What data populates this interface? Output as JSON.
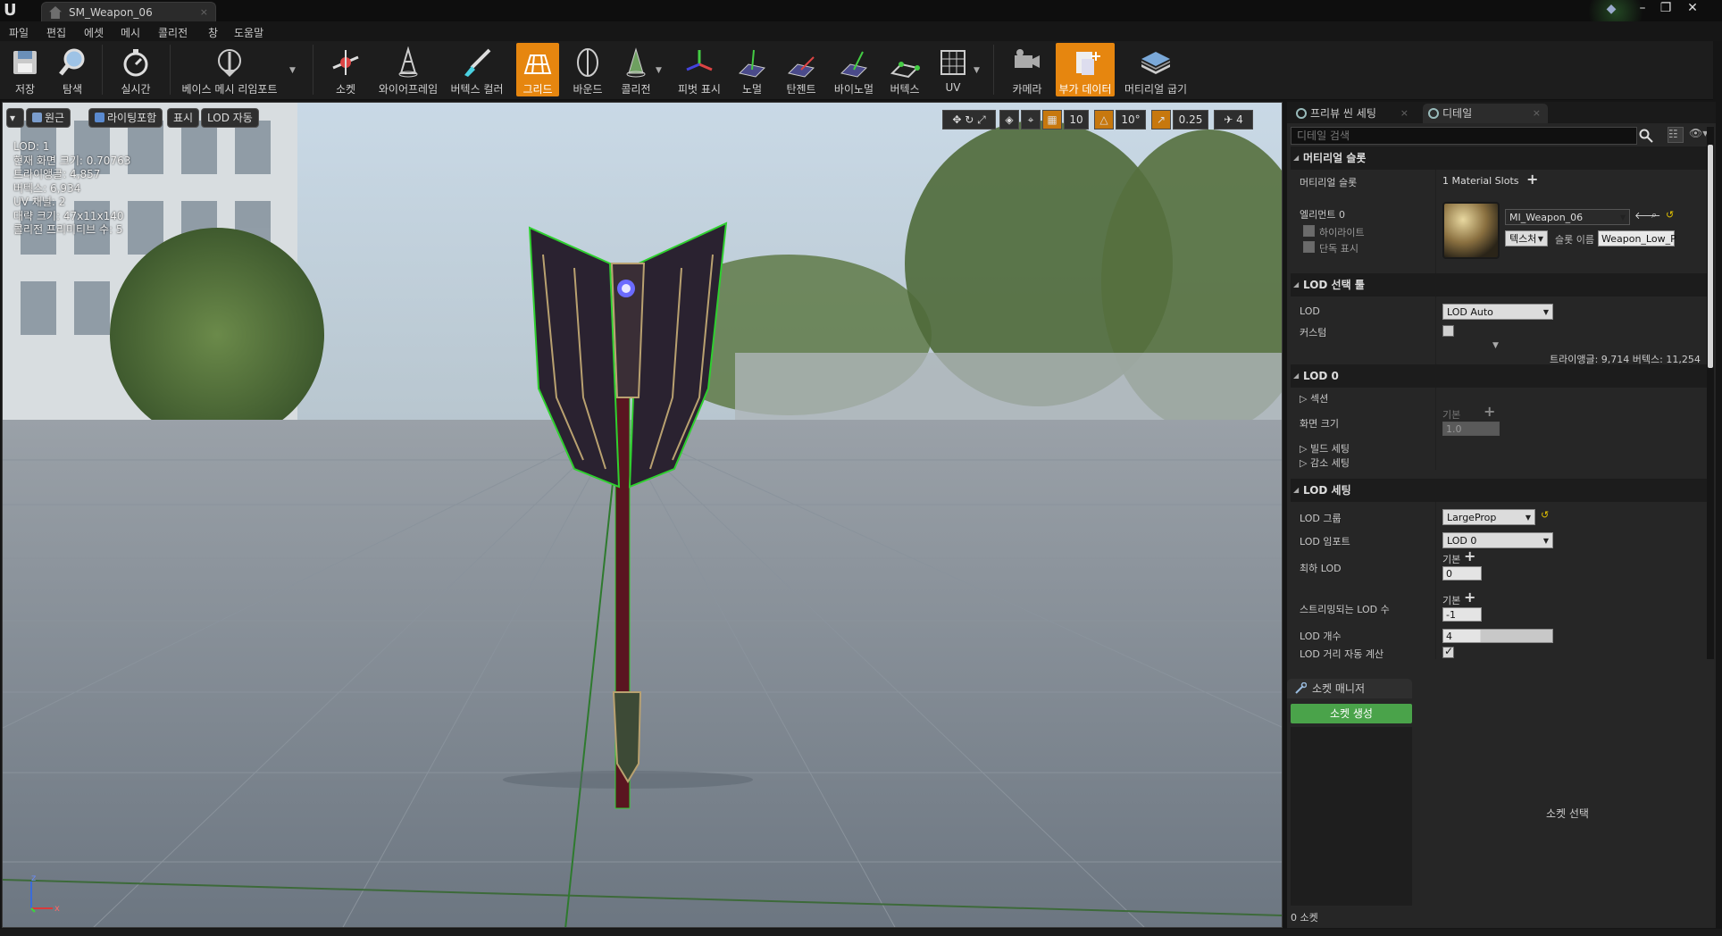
{
  "titlebar": {
    "tab_title": "SM_Weapon_06",
    "tab_close": "×",
    "logo": "U"
  },
  "menu": [
    "파일",
    "편집",
    "에셋",
    "메시",
    "콜리전",
    "창",
    "도움말"
  ],
  "toolbar": {
    "save": "저장",
    "browse": "탐색",
    "realtime": "실시간",
    "reimport": "베이스 메시 리임포트",
    "socket": "소켓",
    "wireframe": "와이어프레임",
    "vertex_color": "버텍스 컬러",
    "grid": "그리드",
    "bounds": "바운드",
    "collision": "콜리전",
    "pivot": "피벗 표시",
    "normal": "노멀",
    "tangent": "탄젠트",
    "binormal": "바이노멀",
    "vertex": "버텍스",
    "uv": "UV",
    "camera": "카메라",
    "additional_data": "부가 데이터",
    "material_bake": "머티리얼 굽기"
  },
  "viewport": {
    "perspective": "원근",
    "lighting": "라이팅포함",
    "show": "표시",
    "lod_auto": "LOD 자동",
    "grid_size": "10",
    "rotation_snap": "10°",
    "scale_snap": "0.25",
    "camera_speed": "4",
    "stats": [
      "LOD:  1",
      "현재 화면 크기: 0.70763",
      "트라이앵글: 4,857",
      "버텍스: 6,934",
      "UV 채널:  2",
      "대략 크기: 47x11x140",
      "콜리전 프리미티브 수: 5"
    ],
    "axis_x": "x",
    "axis_z": "z"
  },
  "panel": {
    "tab_preview": "프리뷰 씬 세팅",
    "tab_details": "디테일",
    "search_placeholder": "디테일 검색",
    "material_slots_header": "머티리얼 슬롯",
    "material_slots_label": "머티리얼 슬롯",
    "material_slots_value": "1 Material Slots",
    "element_label": "엘리먼트 0",
    "highlight_label": "하이라이트",
    "isolate_label": "단독 표시",
    "material_name": "MI_Weapon_06",
    "texture_btn": "텍스처",
    "slot_name_label": "슬롯 이름",
    "slot_name_value": "Weapon_Low_P",
    "lod_picker_header": "LOD 선택 툴",
    "lod_label": "LOD",
    "lod_value": "LOD Auto",
    "custom_label": "커스텀",
    "lod0_header": "LOD 0",
    "lod0_info": "트라이앵글: 9,714   버텍스: 11,254",
    "sections_label": "섹션",
    "screen_size_label": "화면 크기",
    "screen_size_default": "기본",
    "screen_size_value": "1.0",
    "build_settings_label": "빌드 세팅",
    "reduction_settings_label": "감소 세팅",
    "lod_settings_header": "LOD 세팅",
    "lod_group_label": "LOD 그룹",
    "lod_group_value": "LargeProp",
    "lod_import_label": "LOD 임포트",
    "lod_import_value": "LOD 0",
    "min_lod_label": "최하 LOD",
    "min_lod_default": "기본",
    "min_lod_value": "0",
    "streamed_lod_label": "스트리밍되는 LOD 수",
    "streamed_lod_default": "기본",
    "streamed_lod_value": "-1",
    "lod_count_label": "LOD 개수",
    "lod_count_value": "4",
    "lod_auto_distance_label": "LOD 거리 자동 계산"
  },
  "sockets": {
    "tab": "소켓 매니저",
    "create": "소켓 생성",
    "select_hint": "소켓 선택",
    "count": "0 소켓"
  },
  "colors": {
    "accent_orange": "#e6860f",
    "socket_green": "#4aa34a",
    "wire_green": "#2fd02f"
  }
}
